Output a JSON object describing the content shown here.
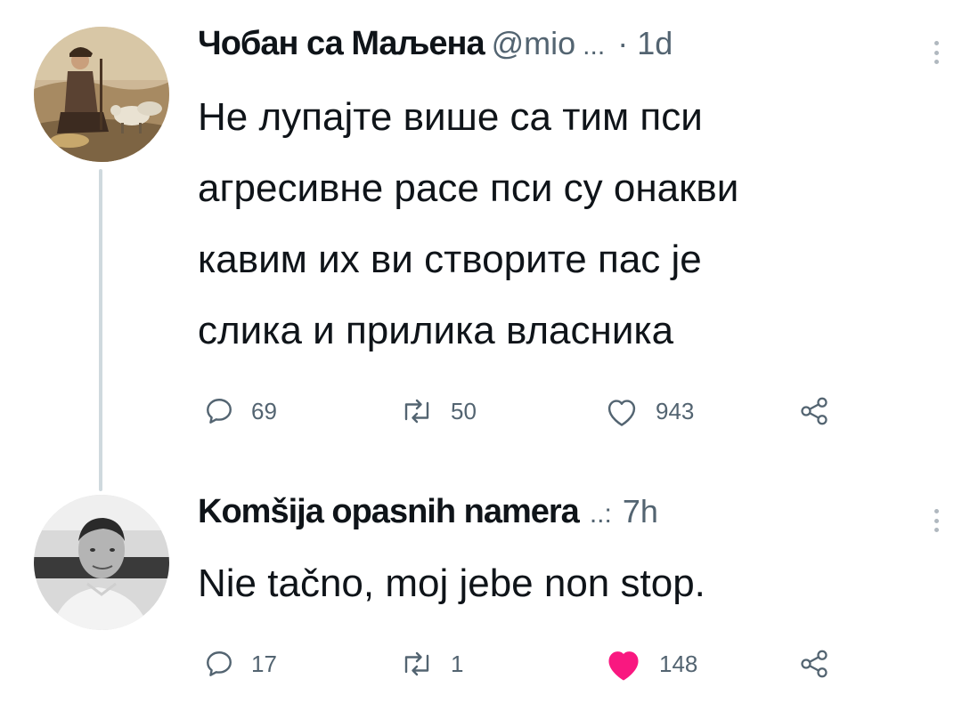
{
  "tweets": [
    {
      "author_name": "Чобан са Маљена",
      "handle": "@mio",
      "handle_truncation": "...",
      "separator": "·",
      "time": "1d",
      "text": "Не лупајте више са тим пси\nагресивне расе пси су онакви\nкавим их ви створите пас је\nслика и прилика власника",
      "replies": "69",
      "retweets": "50",
      "likes": "943",
      "liked": false
    },
    {
      "author_name": "Komšija opasnih namera",
      "handle_truncation": "..:",
      "time": "7h",
      "text": "Nie tačno, moj jebe non stop.",
      "replies": "17",
      "retweets": "1",
      "likes": "148",
      "liked": true
    }
  ],
  "colors": {
    "text_primary": "#0f1419",
    "text_secondary": "#536471",
    "thread_line": "#cfd9de",
    "like_active": "#f91880"
  },
  "icons": [
    "reply-icon",
    "retweet-icon",
    "like-icon",
    "share-icon",
    "more-icon"
  ]
}
